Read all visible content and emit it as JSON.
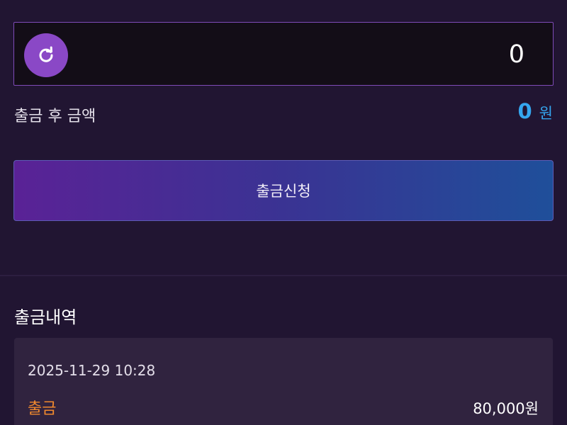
{
  "amount_input": {
    "value": "0"
  },
  "reset_icon": "refresh-icon",
  "after_withdraw": {
    "label": "출금 후 금액",
    "value": "0",
    "unit": "원"
  },
  "submit_button": {
    "label": "출금신청"
  },
  "history": {
    "title": "출금내역",
    "items": [
      {
        "date": "2025-11-29 10:28",
        "type": "출금",
        "amount": "80,000원"
      }
    ]
  },
  "colors": {
    "background": "#211532",
    "input_border": "#7f4bb8",
    "reset_button": "#8a48c6",
    "accent_blue": "#35a6ef",
    "button_gradient_start": "#5a2296",
    "button_gradient_end": "#1f4f9a",
    "withdraw_type": "#f0892e"
  }
}
